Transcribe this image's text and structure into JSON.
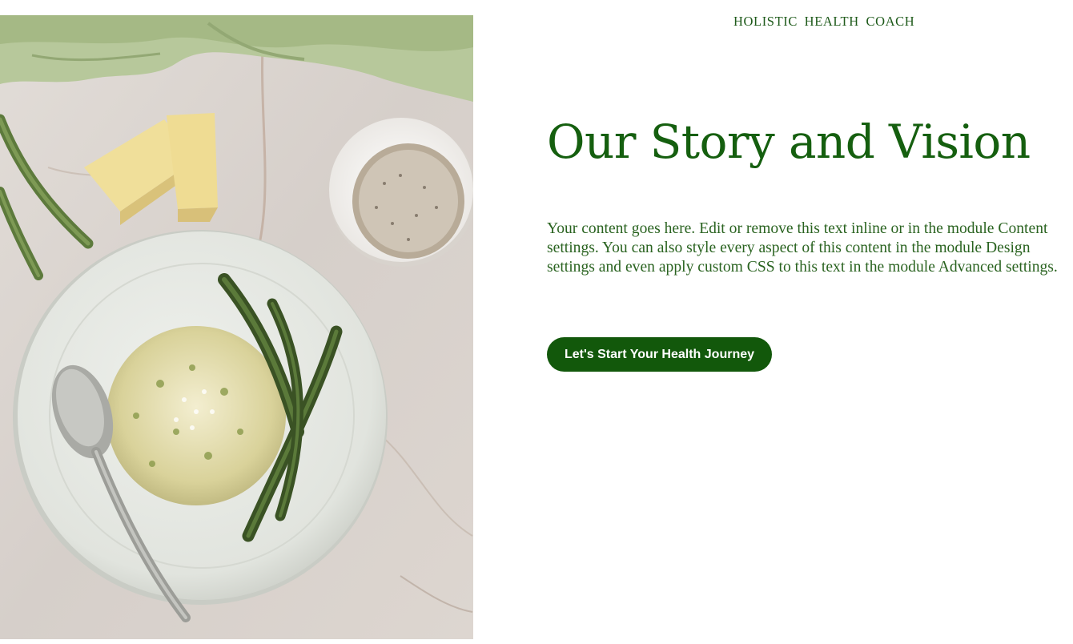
{
  "header": {
    "eyebrow": "HOLISTIC HEALTH COACH"
  },
  "hero": {
    "title": "Our Story and Vision",
    "body": "Your content goes here. Edit or remove this text inline or in the module Content settings. You can also style every aspect of this content in the module Design settings and even apply custom CSS to this text in the module Advanced settings.",
    "cta_label": "Let's Start Your Health Journey"
  },
  "colors": {
    "accent": "#155f0f",
    "button_bg": "#12580b",
    "button_text": "#ffffff",
    "background": "#ffffff"
  }
}
